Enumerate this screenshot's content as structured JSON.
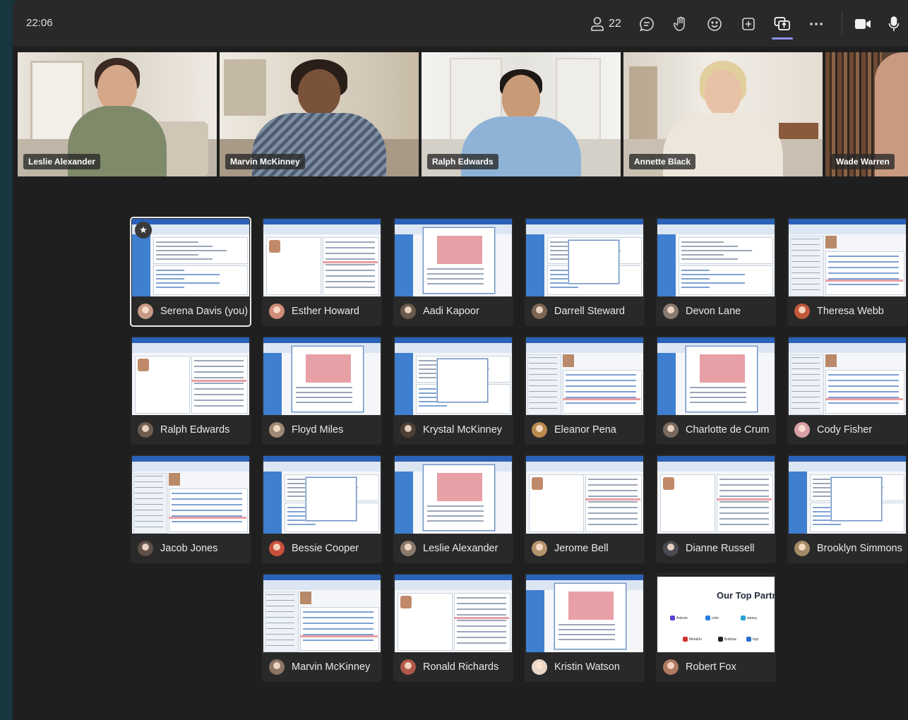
{
  "topbar": {
    "time": "22:06",
    "participant_count": "22",
    "icons": [
      "people-icon",
      "chat-icon",
      "raise-hand-icon",
      "reactions-icon",
      "add-app-icon",
      "share-screen-icon",
      "more-icon",
      "camera-icon",
      "microphone-icon"
    ]
  },
  "video_strip": [
    {
      "name": "Leslie Alexander"
    },
    {
      "name": "Marvin McKinney"
    },
    {
      "name": "Ralph Edwards"
    },
    {
      "name": "Annette Black"
    },
    {
      "name": "Wade Warren"
    }
  ],
  "grid": [
    {
      "name": "Serena Davis (you)",
      "avatar_color": "#c79a86"
    },
    {
      "name": "Esther Howard",
      "avatar_color": "#d08c78"
    },
    {
      "name": "Aadi Kapoor",
      "avatar_color": "#6a5a4a"
    },
    {
      "name": "Darrell Steward",
      "avatar_color": "#7a6453"
    },
    {
      "name": "Devon Lane",
      "avatar_color": "#8b7a70"
    },
    {
      "name": "Theresa Webb",
      "avatar_color": "#c0583a"
    },
    {
      "name": "Ralph Edwards",
      "avatar_color": "#6d5c50"
    },
    {
      "name": "Floyd Miles",
      "avatar_color": "#a08a76"
    },
    {
      "name": "Krystal McKinney",
      "avatar_color": "#4e3f36"
    },
    {
      "name": "Eleanor Pena",
      "avatar_color": "#b98a4e"
    },
    {
      "name": "Charlotte de Crum",
      "avatar_color": "#7a6a5e"
    },
    {
      "name": "Cody Fisher",
      "avatar_color": "#d9a0a8"
    },
    {
      "name": "Jacob Jones",
      "avatar_color": "#5e5048"
    },
    {
      "name": "Bessie Cooper",
      "avatar_color": "#c8503c"
    },
    {
      "name": "Leslie Alexander",
      "avatar_color": "#8a7a6c"
    },
    {
      "name": "Jerome Bell",
      "avatar_color": "#b6946e"
    },
    {
      "name": "Dianne Russell",
      "avatar_color": "#4a4a52"
    },
    {
      "name": "Brooklyn Simmons",
      "avatar_color": "#a48a66"
    },
    {
      "name": "Marvin McKinney",
      "avatar_color": "#8c7466"
    },
    {
      "name": "Ronald Richards",
      "avatar_color": "#b0584a"
    },
    {
      "name": "Kristin Watson",
      "avatar_color": "#e8d6c8"
    },
    {
      "name": "Robert Fox",
      "avatar_color": "#b07a62"
    }
  ],
  "presentation": {
    "title": "Our Top Partn",
    "logos": [
      "Astrum",
      "cicle",
      "weavy",
      "Metablu",
      "Buildaa",
      "Ispi"
    ]
  }
}
